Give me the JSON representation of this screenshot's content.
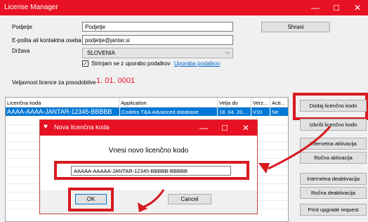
{
  "window": {
    "title": "License Manager",
    "minimize": "—",
    "maximize": "☐",
    "close": "✕"
  },
  "form": {
    "company_label": "Podjetje",
    "company_value": "Podjetje",
    "email_label": "E-pošta ali kontaktna oseba",
    "email_value": "podjetje@jantar.si",
    "country_label": "Država",
    "country_value": "SLOVENIA",
    "agree_text": "Strinjam se z uporabo podatkov",
    "agree_link": "Uporaba podatkov",
    "agree_checked": true,
    "save_button": "Shrani",
    "validity_label": "Veljavnost licence za posodobitve",
    "validity_value": "1. 01. 0001"
  },
  "grid": {
    "columns": [
      "Licenčna koda",
      "Application",
      "Velja do",
      "Verz...",
      "Acti..."
    ],
    "rows": [
      [
        "AAAA-AAAA-JANTAR-12345-BBBBB",
        "Codeks T&A Advanced database",
        "18. 04. 20...",
        "V10",
        "Ne"
      ]
    ]
  },
  "actions": [
    "Dodaj licenčno kodo",
    "Izbriši licenčno kodo",
    "Internetna aktivacija",
    "Ročna aktivacija",
    "Internetna deaktivacija",
    "Ročna deaktivacija",
    "Print upgrade request"
  ],
  "dialog": {
    "title": "Nova licenčna koda",
    "prompt": "Vnesi novo licenčno kodo",
    "code_value": "AAAAA-AAAAA-JANTAR-12345-BBBBB-BBBBB",
    "ok": "OK",
    "cancel": "Cancel"
  },
  "colors": {
    "accent": "#e81123",
    "highlight": "#d71920",
    "selection": "#0078d7",
    "link": "#0066cc"
  }
}
